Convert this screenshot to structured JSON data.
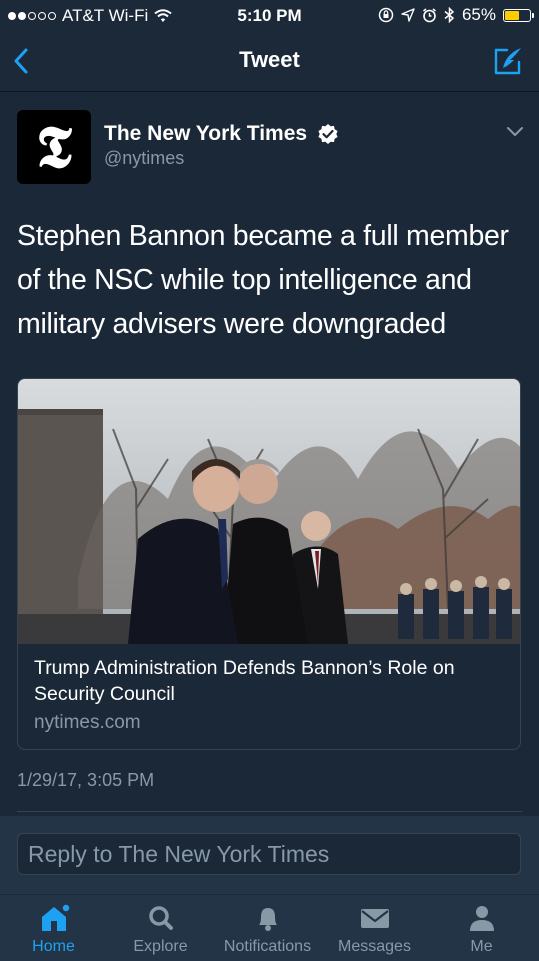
{
  "status_bar": {
    "carrier": "AT&T Wi-Fi",
    "time": "5:10 PM",
    "battery": "65%",
    "battery_level": 0.65
  },
  "nav": {
    "title": "Tweet",
    "back_icon": "chevron-left-icon",
    "compose_icon": "compose-tweet-icon"
  },
  "tweet": {
    "author_name": "The New York Times",
    "handle": "@nytimes",
    "verified": true,
    "text": "Stephen Bannon became a full member of the NSC while top intelligence and military advisers were downgraded",
    "card": {
      "title": "Trump Administration Defends Bannon’s Role on Security Council",
      "domain": "nytimes.com"
    },
    "timestamp": "1/29/17, 3:05 PM"
  },
  "reply": {
    "placeholder": "Reply to The New York Times"
  },
  "tabs": [
    {
      "label": "Home",
      "icon": "home-icon",
      "active": true
    },
    {
      "label": "Explore",
      "icon": "search-icon",
      "active": false
    },
    {
      "label": "Notifications",
      "icon": "bell-icon",
      "active": false
    },
    {
      "label": "Messages",
      "icon": "envelope-icon",
      "active": false
    },
    {
      "label": "Me",
      "icon": "person-icon",
      "active": false
    }
  ],
  "colors": {
    "background": "#1b2838",
    "bar": "#243447",
    "accent": "#1da1f2",
    "muted": "#8899a6"
  }
}
